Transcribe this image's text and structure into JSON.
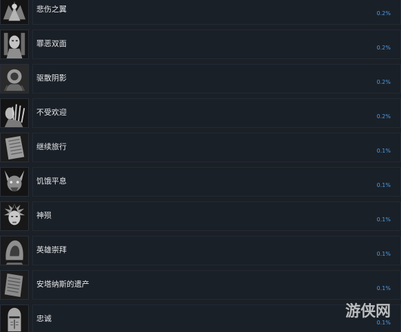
{
  "achievements": [
    {
      "name": "悲伤之翼",
      "percent": "0.2%",
      "icon": "winged-figure-icon"
    },
    {
      "name": "罪恶双面",
      "percent": "0.2%",
      "icon": "two-faced-statue-icon"
    },
    {
      "name": "驱散阴影",
      "percent": "0.2%",
      "icon": "shadow-creature-icon"
    },
    {
      "name": "不受欢迎",
      "percent": "0.2%",
      "icon": "clawed-hand-icon"
    },
    {
      "name": "继续旅行",
      "percent": "0.1%",
      "icon": "stone-tablet-icon"
    },
    {
      "name": "饥饿平息",
      "percent": "0.1%",
      "icon": "horned-beast-icon"
    },
    {
      "name": "神殒",
      "percent": "0.1%",
      "icon": "divine-head-icon"
    },
    {
      "name": "英雄崇拜",
      "percent": "0.1%",
      "icon": "hooded-figure-icon"
    },
    {
      "name": "安塔纳斯的遗产",
      "percent": "0.1%",
      "icon": "engraved-tablet-icon"
    },
    {
      "name": "忠诚",
      "percent": "0.1%",
      "icon": "knight-helmet-icon"
    }
  ],
  "watermark": {
    "text": "游侠网",
    "icon": "watermark-logo-icon"
  }
}
